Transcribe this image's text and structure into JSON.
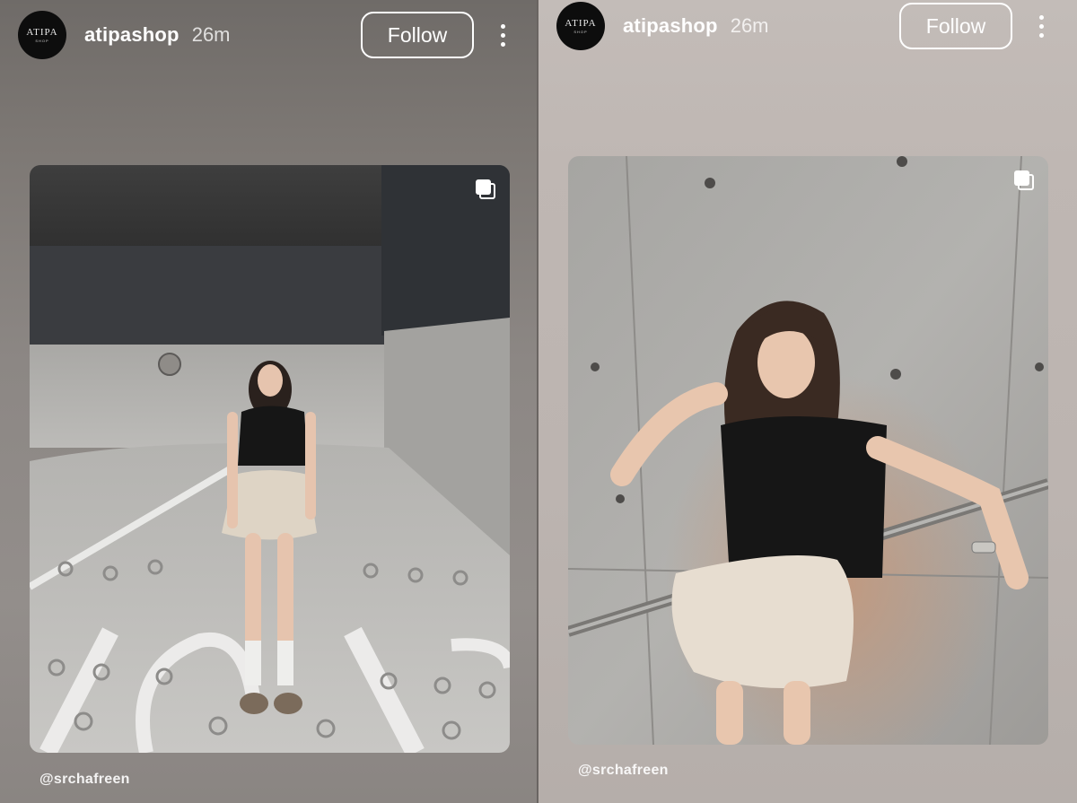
{
  "colors": {
    "left_background": "#8c8784",
    "right_background": "#bcb4b0",
    "follow_border": "#ffffff",
    "avatar_background": "#0d0d0d"
  },
  "stories": [
    {
      "avatar": {
        "logo_text": "ATIPA",
        "logo_subtext": "SHOP"
      },
      "username": "atipashop",
      "timestamp": "26m",
      "follow_label": "Follow",
      "more_icon": "more-vertical-icon",
      "media_icon": "carousel-multi-image-icon",
      "credit": "@srchafreen"
    },
    {
      "avatar": {
        "logo_text": "ATIPA",
        "logo_subtext": "SHOP"
      },
      "username": "atipashop",
      "timestamp": "26m",
      "follow_label": "Follow",
      "more_icon": "more-vertical-icon",
      "media_icon": "carousel-multi-image-icon",
      "credit": "@srchafreen"
    }
  ]
}
